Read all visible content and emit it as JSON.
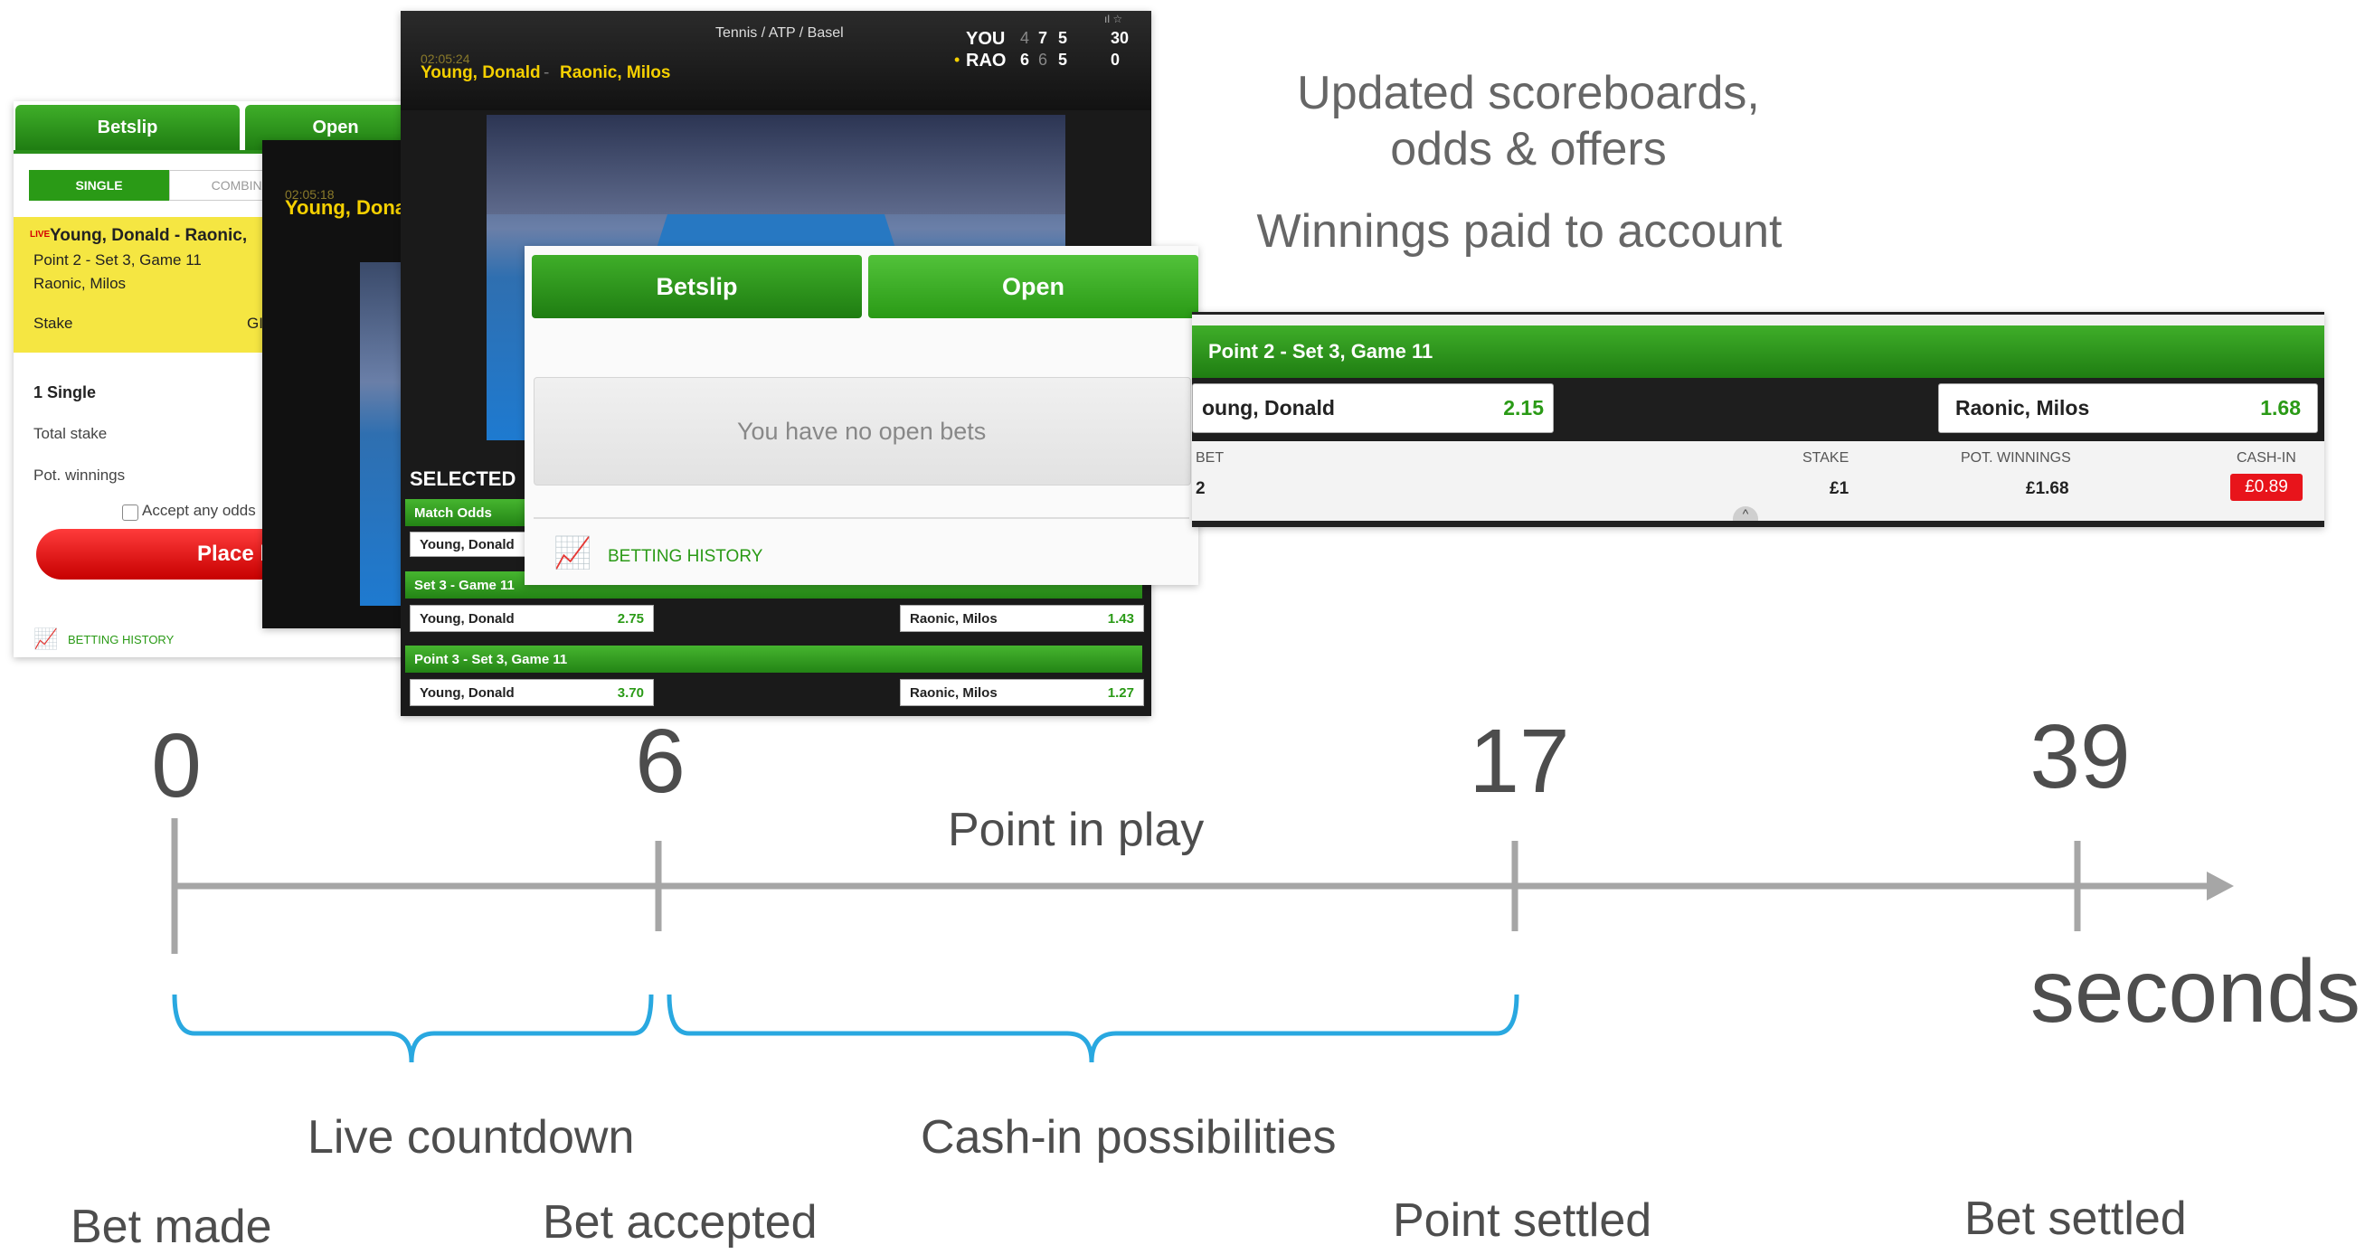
{
  "annotations": {
    "updated_line1": "Updated scoreboards,",
    "updated_line2": "odds & offers",
    "winnings": "Winnings paid to account"
  },
  "timeline": {
    "ticks": [
      "0",
      "6",
      "17",
      "39"
    ],
    "unit": "seconds",
    "point_in_play": "Point in play",
    "live_countdown": "Live countdown",
    "cash_in": "Cash-in possibilities",
    "events": [
      "Bet made",
      "Bet accepted",
      "Point settled",
      "Bet settled"
    ]
  },
  "betslip_panel": {
    "tab_betslip": "Betslip",
    "tab_open": "Open",
    "toggle_single": "SINGLE",
    "toggle_combination": "COMBINATI",
    "live_tag": "LIVE",
    "match": "Young, Donald  -  Raonic,",
    "market": "Point 2 - Set 3, Game 11",
    "selection": "Raonic, Milos",
    "stake_label": "Stake",
    "stake_suffix": "GI",
    "single_count": "1 Single",
    "total_stake": "Total stake",
    "pot_winnings": "Pot. winnings",
    "accept_odds": "Accept any odds",
    "place_button": "Place b",
    "history": "BETTING HISTORY"
  },
  "video_small": {
    "time": "02:05:18",
    "players": "Young, Dona"
  },
  "scoreboard": {
    "competition": "Tennis / ATP / Basel",
    "time": "02:05:24",
    "player1": "Young, Donald",
    "player2": "Raonic, Milos",
    "row1_name": "YOU",
    "row1_sets": [
      "4",
      "7",
      "5"
    ],
    "row1_points": "30",
    "row2_name": "RAO",
    "row2_sets": [
      "6",
      "6",
      "5"
    ],
    "row2_points": "0"
  },
  "markets": {
    "selected": "SELECTED",
    "match_odds": "Match Odds",
    "match_odds_player": "Young, Donald",
    "set_game": "Set 3 - Game 11",
    "set_game_p1": "Young, Donald",
    "set_game_p1_odds": "2.75",
    "set_game_p2": "Raonic, Milos",
    "set_game_p2_odds": "1.43",
    "point": "Point 3 - Set 3, Game 11",
    "point_p1": "Young, Donald",
    "point_p1_odds": "3.70",
    "point_p2": "Raonic, Milos",
    "point_p2_odds": "1.27"
  },
  "open_panel": {
    "tab_betslip": "Betslip",
    "tab_open": "Open",
    "empty": "You have no open bets",
    "history": "BETTING HISTORY"
  },
  "cashin_panel": {
    "market": "Point 2 - Set 3, Game 11",
    "p1": "oung, Donald",
    "p1_odds": "2.15",
    "p2": "Raonic, Milos",
    "p2_odds": "1.68",
    "col_bet": "BET",
    "col_stake": "STAKE",
    "col_pot": "POT. WINNINGS",
    "col_cashin": "CASH-IN",
    "bet_val": "2",
    "stake_val": "£1",
    "pot_val": "£1.68",
    "cashin_val": "£0.89"
  },
  "colors": {
    "green": "#2a9a16",
    "blue_brace": "#29a8e0",
    "timeline_gray": "#a6a6a6",
    "cashin_red": "#e8141b"
  }
}
